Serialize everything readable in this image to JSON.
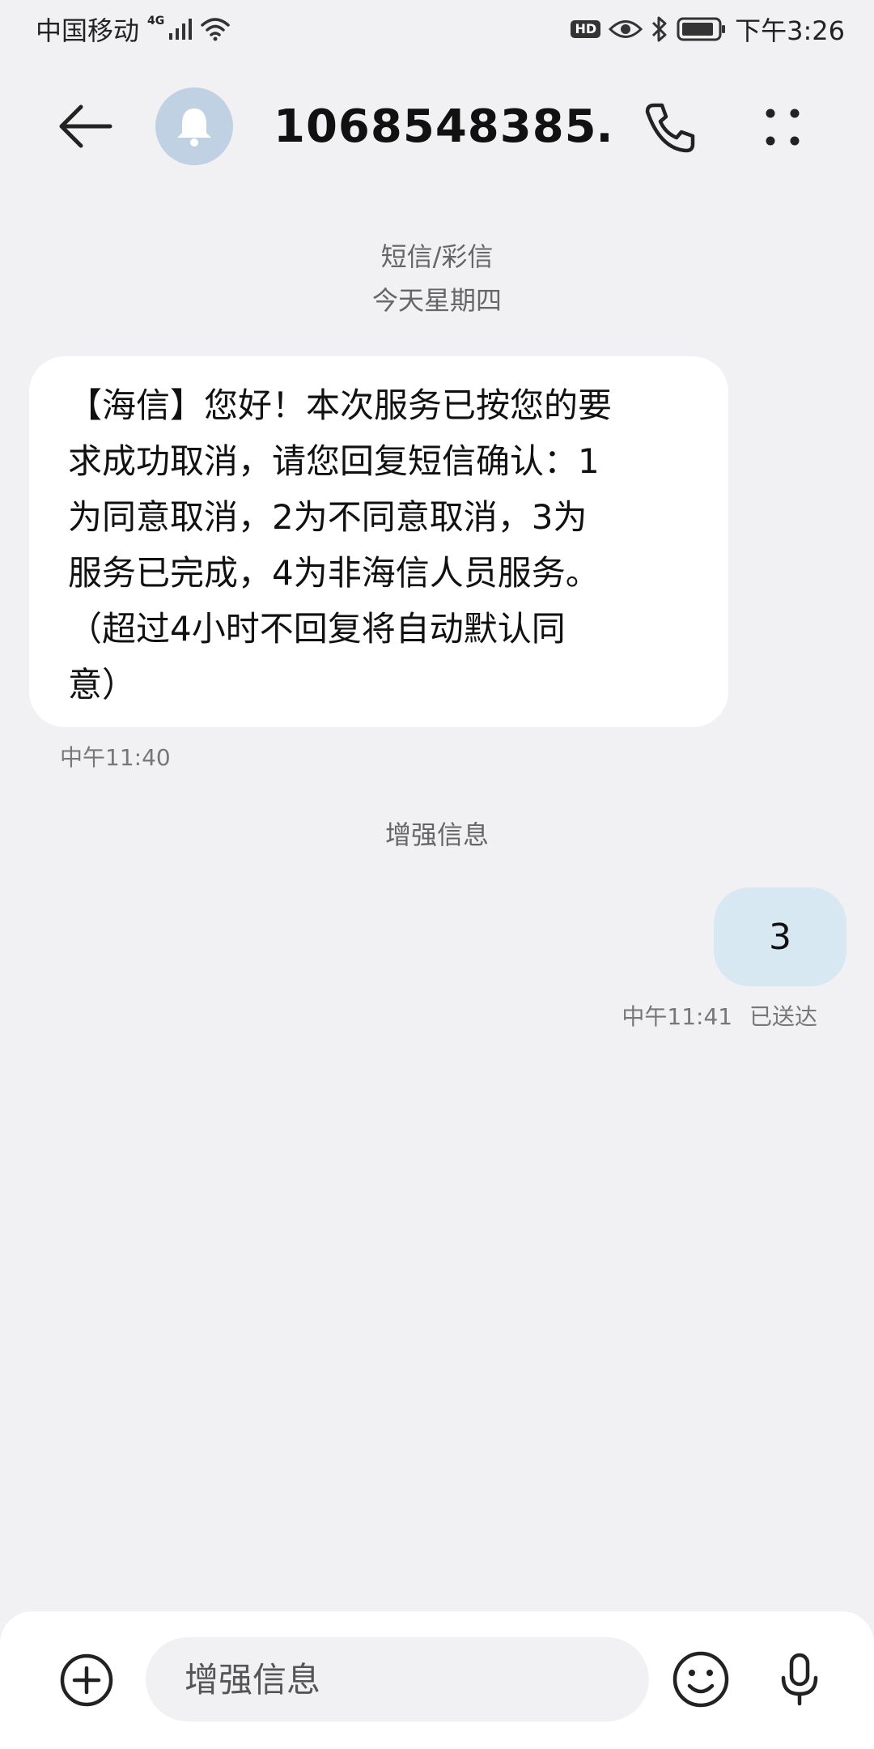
{
  "status_bar": {
    "carrier": "中国移动",
    "network": "4G",
    "hd": "HD",
    "time": "下午3:26"
  },
  "header": {
    "contact": "1068548385…"
  },
  "thread": {
    "channel_label": "短信/彩信",
    "date_label": "今天星期四",
    "incoming": {
      "lines": [
        "【海信】您好！本次服务已按您的要",
        "求成功取消，请您回复短信确认：1",
        "为同意取消，2为不同意取消，3为",
        "服务已完成，4为非海信人员服务。",
        "（超过4小时不回复将自动默认同",
        "意）"
      ],
      "time": "中午11:40"
    },
    "divider_label": "增强信息",
    "outgoing": {
      "text": "3",
      "time": "中午11:41",
      "status": "已送达"
    }
  },
  "input_bar": {
    "placeholder": "增强信息"
  },
  "icons": {
    "accent": "#bfd1e2",
    "outgoing_bubble": "#d8e8f3"
  }
}
